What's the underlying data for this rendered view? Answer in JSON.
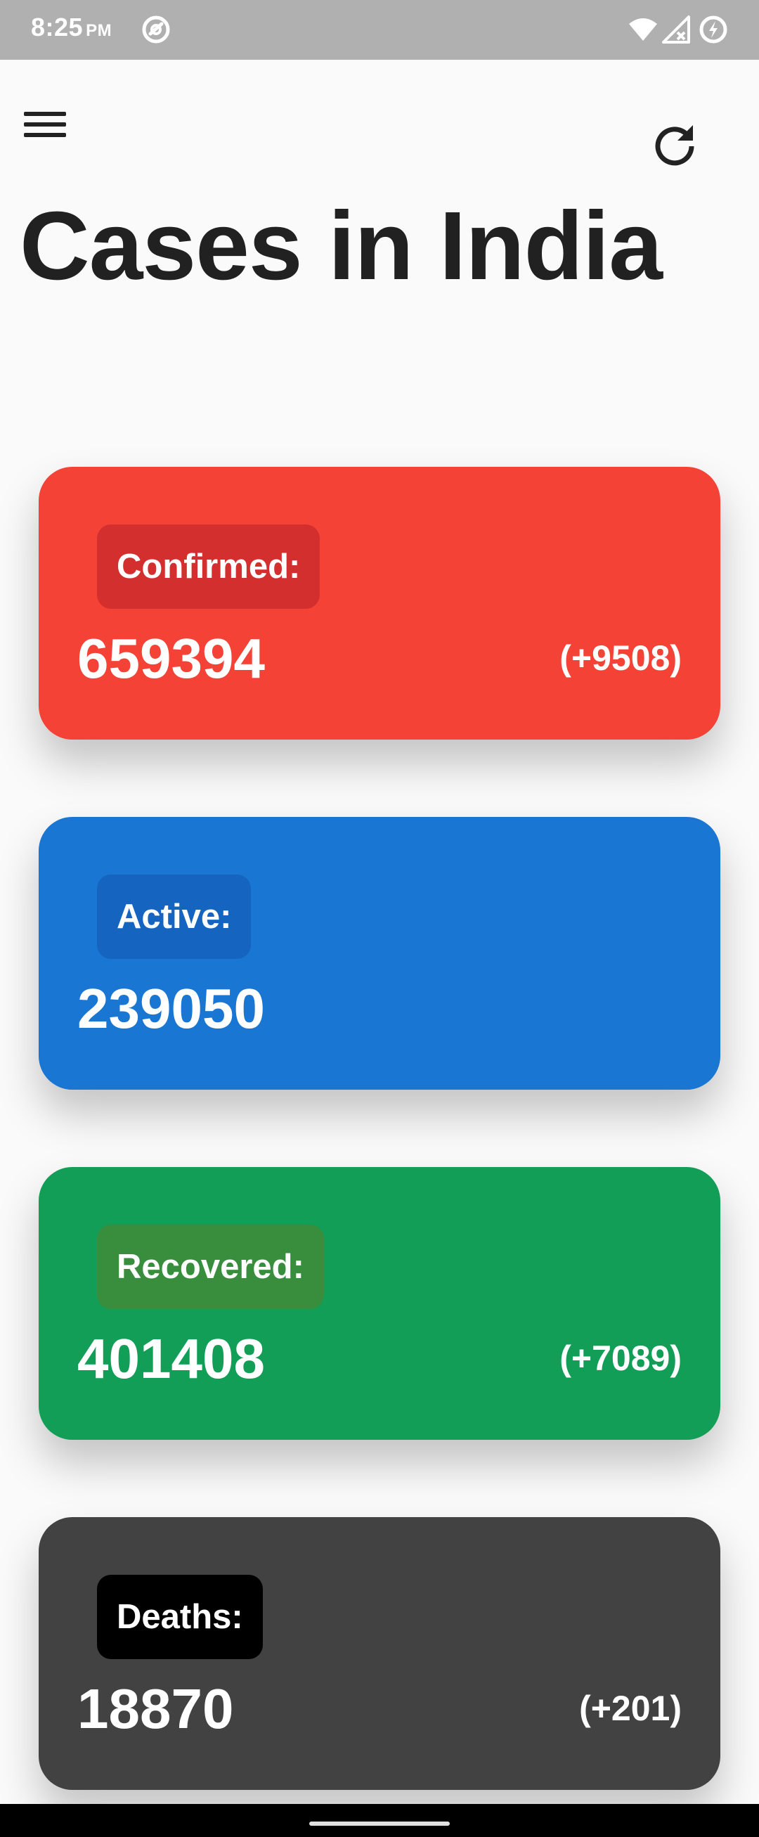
{
  "status_bar": {
    "time": "8:25",
    "ampm": "PM",
    "icons": [
      "do-not-disturb-icon",
      "wifi-icon",
      "signal-icon",
      "battery-saver-icon"
    ]
  },
  "header": {
    "menu_icon": "hamburger-menu-icon",
    "refresh_icon": "refresh-icon",
    "title": "Cases in India"
  },
  "cards": [
    {
      "id": "confirmed",
      "label": "Confirmed:",
      "value": "659394",
      "delta": "(+9508)",
      "color": "#f44336",
      "label_color": "#d32f2f"
    },
    {
      "id": "active",
      "label": "Active:",
      "value": "239050",
      "delta": "",
      "color": "#1976d2",
      "label_color": "#1565c0"
    },
    {
      "id": "recovered",
      "label": "Recovered:",
      "value": "401408",
      "delta": "(+7089)",
      "color": "#139e57",
      "label_color": "#388e3c"
    },
    {
      "id": "deaths",
      "label": "Deaths:",
      "value": "18870",
      "delta": "(+201)",
      "color": "#424242",
      "label_color": "#000000"
    }
  ]
}
